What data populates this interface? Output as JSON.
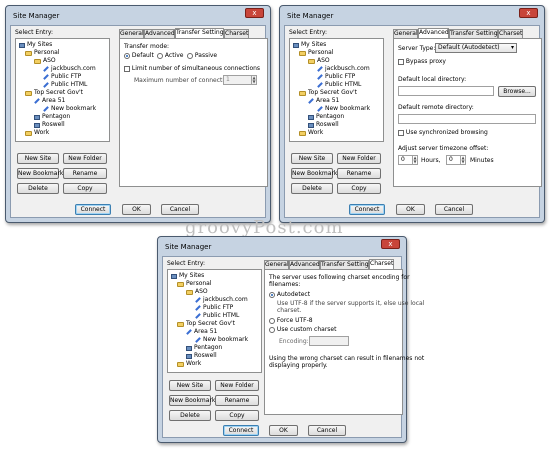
{
  "watermark": "groovyPost.com",
  "common": {
    "title": "Site Manager",
    "close_glyph": "x",
    "select_entry": "Select Entry:",
    "tree": [
      "My Sites",
      "Personal",
      "ASO",
      "jackbusch.com",
      "Public FTP",
      "Public HTML",
      "Top Secret Gov't",
      "Area 51",
      "New bookmark",
      "Pentagon",
      "Roswell",
      "Work"
    ],
    "buttons": {
      "new_site": "New Site",
      "new_folder": "New Folder",
      "new_bookmark": "New Bookmark",
      "rename": "Rename",
      "delete": "Delete",
      "copy": "Copy",
      "connect": "Connect",
      "ok": "OK",
      "cancel": "Cancel"
    },
    "tabs": [
      "General",
      "Advanced",
      "Transfer Settings",
      "Charset"
    ]
  },
  "transfer": {
    "active_tab": "Transfer Settings",
    "mode_label": "Transfer mode:",
    "modes": [
      "Default",
      "Active",
      "Passive"
    ],
    "selected_mode": "Default",
    "limit_label": "Limit number of simultaneous connections",
    "max_label": "Maximum number of connections:",
    "max_value": "1"
  },
  "advanced": {
    "active_tab": "Advanced",
    "server_type_label": "Server Type:",
    "server_type_value": "Default (Autodetect)",
    "bypass_proxy": "Bypass proxy",
    "local_dir_label": "Default local directory:",
    "local_dir_value": "",
    "browse": "Browse...",
    "remote_dir_label": "Default remote directory:",
    "remote_dir_value": "",
    "sync_browsing": "Use synchronized browsing",
    "tz_label": "Adjust server timezone offset:",
    "hours_value": "0",
    "hours_label": "Hours,",
    "minutes_value": "0",
    "minutes_label": "Minutes"
  },
  "charset": {
    "active_tab": "Charset",
    "intro": [
      "The server uses following charset encoding for",
      "filenames:"
    ],
    "autodetect": "Autodetect",
    "autodetect_desc": [
      "Use UTF-8 if the server supports it, else use local",
      "charset."
    ],
    "force_utf8": "Force UTF-8",
    "custom": "Use custom charset",
    "encoding_label": "Encoding:",
    "encoding_value": "",
    "warning": [
      "Using the wrong charset can result in filenames not",
      "displaying properly."
    ]
  }
}
